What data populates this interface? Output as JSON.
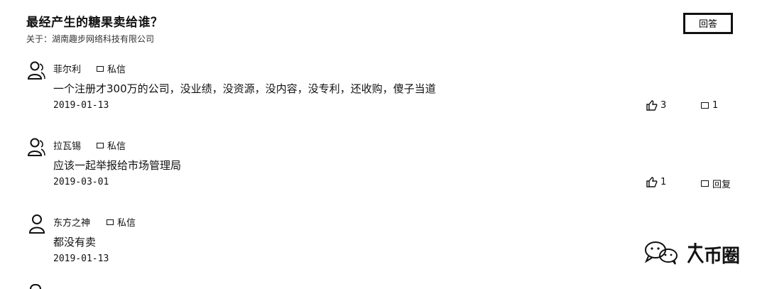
{
  "question": {
    "title": "最经产生的糖果卖给谁？",
    "about": "关于：湖南趣步网络科技有限公司",
    "answer_label": "回答"
  },
  "comments": [
    {
      "user": "菲尔利",
      "pm_label": "私信",
      "text": "一个注册才300万的公司，没业绩，没资源，没内容，没专利，还收购，傻子当道",
      "date": "2019-01-13",
      "likes": "3",
      "reply": "1"
    },
    {
      "user": "拉瓦锡",
      "pm_label": "私信",
      "text": "应该一起举报给市场管理局",
      "date": "2019-03-01",
      "likes": "1",
      "reply": "回复"
    },
    {
      "user": "东方之神",
      "pm_label": "私信",
      "text": "都没有卖",
      "date": "2019-01-13"
    }
  ],
  "watermark": {
    "text": "币圈"
  },
  "icons": [
    "user-avatar-icon",
    "mail-icon",
    "thumbs-up-icon",
    "comment-icon",
    "wechat-icon"
  ]
}
